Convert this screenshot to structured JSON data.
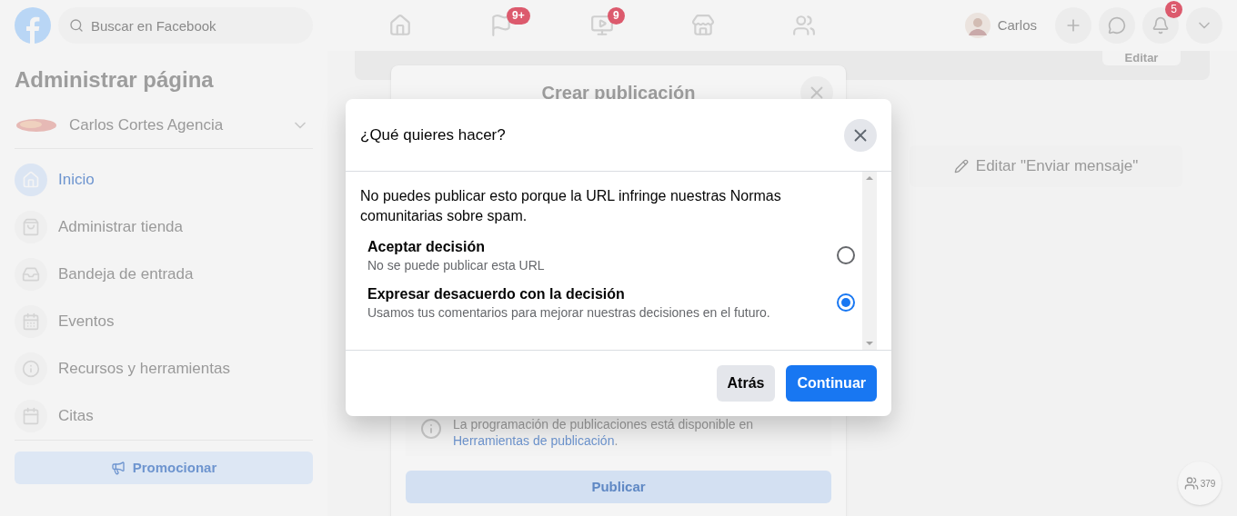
{
  "topbar": {
    "search_placeholder": "Buscar en Facebook",
    "nav": [
      {
        "kind": "home"
      },
      {
        "kind": "flag",
        "badge": "9+"
      },
      {
        "kind": "video",
        "badge": "9"
      },
      {
        "kind": "store"
      },
      {
        "kind": "groups"
      }
    ],
    "profile_name": "Carlos",
    "actions": [
      {
        "kind": "plus"
      },
      {
        "kind": "messenger"
      },
      {
        "kind": "bell",
        "badge": "5"
      },
      {
        "kind": "caret"
      }
    ]
  },
  "sidebar": {
    "title": "Administrar página",
    "page_name": "Carlos Cortes Agencia",
    "items": [
      {
        "kind": "home",
        "label": "Inicio",
        "selected": true
      },
      {
        "kind": "shop",
        "label": "Administrar tienda",
        "selected": false
      },
      {
        "kind": "inbox",
        "label": "Bandeja de entrada",
        "selected": false
      },
      {
        "kind": "events",
        "label": "Eventos",
        "selected": false
      },
      {
        "kind": "info",
        "label": "Recursos y herramientas",
        "selected": false
      },
      {
        "kind": "calendar",
        "label": "Citas",
        "selected": false
      }
    ],
    "promote_button": "Promocionar"
  },
  "main": {
    "edit_button": "Editar",
    "message_button": "Editar \"Enviar mensaje\"",
    "contacts_count": "379"
  },
  "create_post": {
    "title": "Crear publicación",
    "info_text": "La programación de publicaciones está disponible en",
    "info_link": "Herramientas de publicación",
    "info_end": ".",
    "publish_button": "Publicar"
  },
  "dialog": {
    "title": "¿Qué quieres hacer?",
    "message": "No puedes publicar esto porque la URL infringe nuestras Normas comunitarias sobre spam.",
    "options": [
      {
        "title": "Aceptar decisión",
        "description": "No se puede publicar esta URL",
        "selected": false
      },
      {
        "title": "Expresar desacuerdo con la decisión",
        "description": "Usamos tus comentarios para mejorar nuestras decisiones en el futuro.",
        "selected": true
      }
    ],
    "buttons": [
      {
        "kind": "secondary",
        "label": "Atrás"
      },
      {
        "kind": "primary",
        "label": "Continuar"
      }
    ]
  }
}
